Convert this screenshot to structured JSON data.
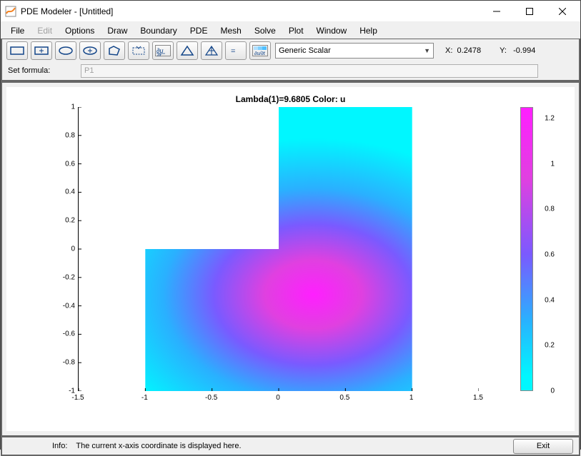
{
  "window": {
    "title": "PDE Modeler - [Untitled]"
  },
  "menu": {
    "file": "File",
    "edit": "Edit",
    "options": "Options",
    "draw": "Draw",
    "boundary": "Boundary",
    "pde": "PDE",
    "mesh": "Mesh",
    "solve": "Solve",
    "plot": "Plot",
    "window": "Window",
    "help": "Help"
  },
  "toolbar": {
    "type_selector": "Generic Scalar",
    "coord_x_label": "X:  ",
    "coord_x_value": "0.2478",
    "coord_y_label": "Y:   ",
    "coord_y_value": "-0.994"
  },
  "formula": {
    "label": "Set formula:",
    "value": "P1"
  },
  "status": {
    "info_label": "Info:",
    "info_text": "The current x-axis coordinate is displayed here.",
    "exit": "Exit"
  },
  "chart_data": {
    "type": "heatmap",
    "title": "Lambda(1)=9.6805   Color: u",
    "xlabel": "",
    "ylabel": "",
    "xlim": [
      -1.5,
      1.5
    ],
    "ylim": [
      -1,
      1
    ],
    "xticks": [
      -1.5,
      -1,
      -0.5,
      0,
      0.5,
      1,
      1.5
    ],
    "yticks": [
      -1,
      -0.8,
      -0.6,
      -0.4,
      -0.2,
      0,
      0.2,
      0.4,
      0.6,
      0.8,
      1
    ],
    "colorbar": {
      "min": 0,
      "max": 1.25,
      "ticks": [
        0,
        0.2,
        0.4,
        0.6,
        0.8,
        1,
        1.2
      ]
    },
    "domain": "L-shaped region: union of [-1,1]x[-1,0] and [0,1]x[0,1]",
    "peak_location": [
      0.25,
      -0.35
    ],
    "peak_value": 1.25
  }
}
